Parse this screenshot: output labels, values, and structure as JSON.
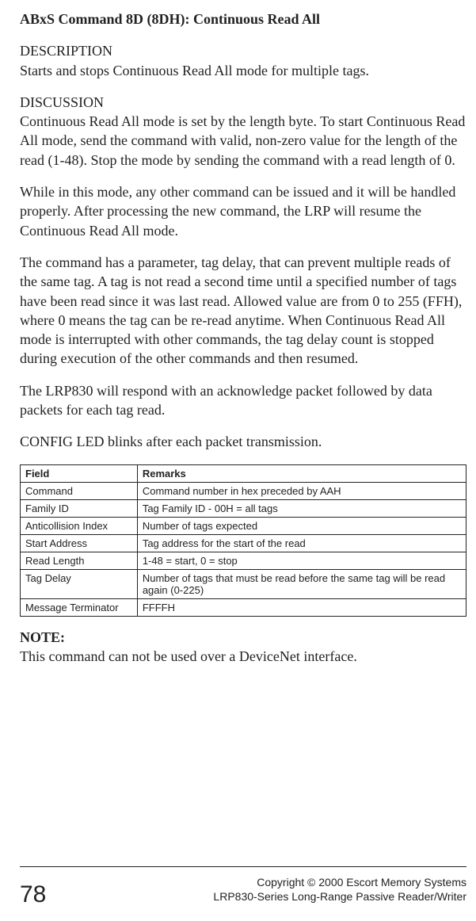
{
  "title": "ABxS Command 8D (8DH): Continuous Read All",
  "description": {
    "label": "DESCRIPTION",
    "text": "Starts and stops Continuous Read All mode for multiple tags."
  },
  "discussion": {
    "label": "DISCUSSION",
    "p1": "Continuous Read All mode is set by the length byte. To start Continuous Read All mode, send the command with valid, non-zero value for the length of the read (1-48). Stop the mode by sending the command with a read length of 0.",
    "p2": "While in this mode, any other command can be issued and it will be handled properly. After processing the new command, the LRP will resume the Continuous Read All mode.",
    "p3": "The command has a parameter, tag delay, that can prevent multiple reads of the same tag.  A tag is not read a second time until a specified number of tags have been read since it was last read. Allowed value are from 0 to 255 (FFH), where 0 means the tag can be re-read anytime. When Continuous Read All mode is interrupted with other commands, the tag delay count is stopped during execution of the other commands and then resumed.",
    "p4": "The LRP830 will respond with an acknowledge packet followed by data packets for each tag read.",
    "p5": "CONFIG LED blinks after each packet transmission."
  },
  "table": {
    "headers": {
      "field": "Field",
      "remarks": "Remarks"
    },
    "rows": [
      {
        "field": "Command",
        "remarks": "Command number in hex preceded by AAH"
      },
      {
        "field": "Family ID",
        "remarks": "Tag Family ID - 00H = all tags"
      },
      {
        "field": "Anticollision Index",
        "remarks": "Number of tags expected"
      },
      {
        "field": "Start Address",
        "remarks": "Tag address for the start of the read"
      },
      {
        "field": "Read Length",
        "remarks": "1-48 = start, 0 = stop"
      },
      {
        "field": "Tag Delay",
        "remarks": "Number of tags that must be read before the same tag will be read again (0-225)"
      },
      {
        "field": "Message Terminator",
        "remarks": "FFFFH"
      }
    ]
  },
  "note": {
    "label": "NOTE:",
    "text": "This command can not be used over a DeviceNet interface."
  },
  "footer": {
    "page_number": "78",
    "line1": "Copyright © 2000 Escort Memory Systems",
    "line2": "LRP830-Series Long-Range Passive Reader/Writer"
  }
}
